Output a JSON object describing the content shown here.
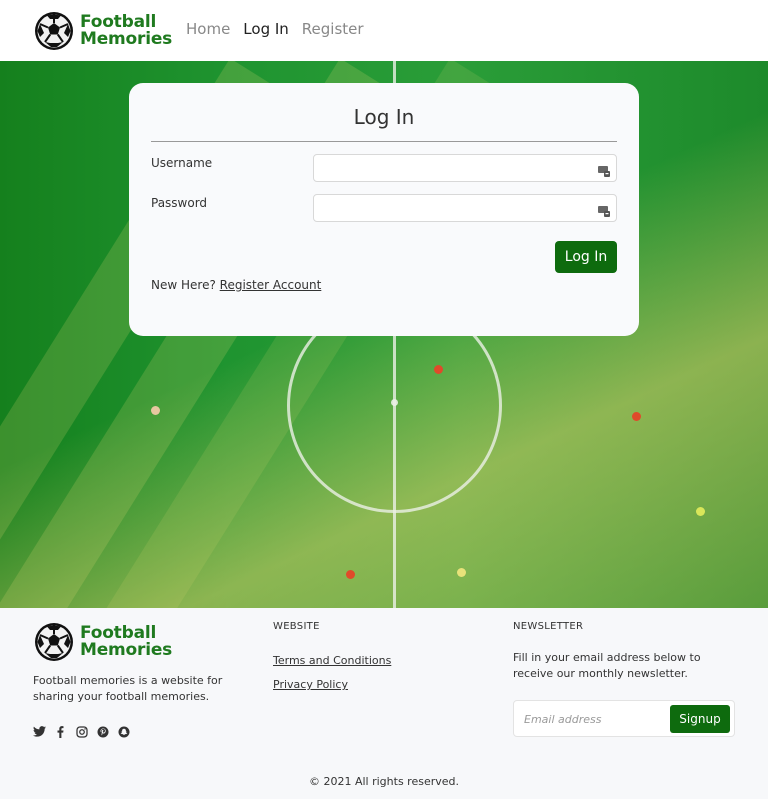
{
  "brand": {
    "line1": "Football",
    "line2": "Memories",
    "color": "#1f7a1f"
  },
  "nav": {
    "home": "Home",
    "login": "Log In",
    "register": "Register"
  },
  "login_card": {
    "title": "Log In",
    "username_label": "Username",
    "password_label": "Password",
    "username_value": "",
    "password_value": "",
    "submit_label": "Log In",
    "new_here": "New Here?",
    "register_link": "Register Account",
    "field_icon": "keyboard-icon"
  },
  "footer": {
    "about": "Football memories is a website for sharing your football memories.",
    "social_icons": [
      "twitter-icon",
      "facebook-icon",
      "instagram-icon",
      "pinterest-icon",
      "snapchat-icon"
    ],
    "website_title": "WEBSITE",
    "terms_link": "Terms and Conditions",
    "privacy_link": "Privacy Policy",
    "newsletter_title": "NEWSLETTER",
    "newsletter_text": "Fill in your email address below to receive our monthly newsletter.",
    "email_placeholder": "Email address",
    "signup_label": "Signup",
    "copyright": "© 2021 All rights reserved."
  },
  "colors": {
    "accent": "#0e6b0e",
    "pitch": "#1f9430"
  }
}
